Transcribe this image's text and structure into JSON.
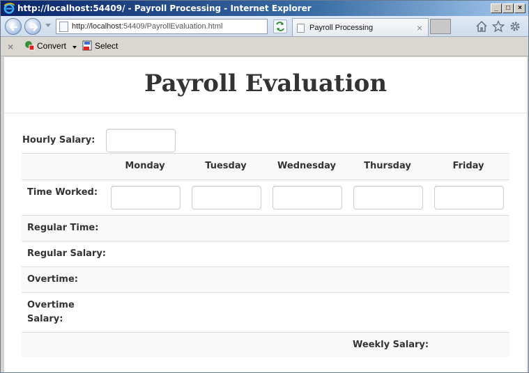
{
  "browser": {
    "window_title": "http://localhost:54409/ - Payroll Processing - Internet Explorer",
    "url_prefix": "http://localhost",
    "url_rest": ":54409/PayrollEvaluation.html",
    "tab_label": "Payroll Processing",
    "tab_close": "×",
    "window_buttons": {
      "minimize": "_",
      "maximize": "□",
      "close": "×"
    }
  },
  "commandbar": {
    "close_glyph": "×",
    "convert_label": "Convert",
    "select_label": "Select"
  },
  "page": {
    "title": "Payroll Evaluation",
    "hourly_salary_label": "Hourly Salary:",
    "hourly_salary_value": "",
    "days": [
      "Monday",
      "Tuesday",
      "Wednesday",
      "Thursday",
      "Friday"
    ],
    "time_worked_label": "Time Worked:",
    "time_worked_values": [
      "",
      "",
      "",
      "",
      ""
    ],
    "rows": {
      "regular_time": "Regular Time:",
      "regular_salary": "Regular Salary:",
      "overtime": "Overtime:",
      "overtime_salary_line1": "Overtime",
      "overtime_salary_line2": "Salary:",
      "weekly_salary": "Weekly Salary:"
    }
  },
  "colors": {
    "title_text": "#333333",
    "border": "#dddddd",
    "stripe": "#f9f9f9",
    "input_border": "#cccccc"
  },
  "icons": [
    "ie-logo-icon",
    "back-icon",
    "forward-icon",
    "search-icon",
    "refresh-icon",
    "home-icon",
    "star-icon",
    "gear-icon",
    "convert-icon",
    "select-icon"
  ]
}
